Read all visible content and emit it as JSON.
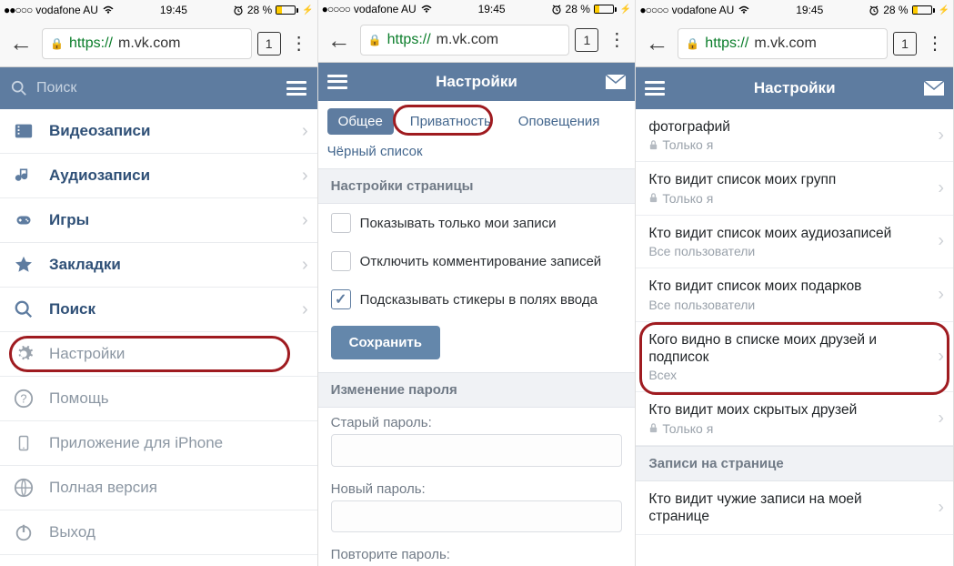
{
  "status": {
    "carrier": "vodafone AU",
    "time": "19:45",
    "battery_pct": "28 %"
  },
  "chrome": {
    "url_prefix": "https://",
    "url_host": "m.vk.com",
    "tabs": "1"
  },
  "pane1": {
    "search_placeholder": "Поиск",
    "menu": [
      {
        "icon": "video",
        "label": "Видеозаписи",
        "active": true
      },
      {
        "icon": "audio",
        "label": "Аудиозаписи",
        "active": true
      },
      {
        "icon": "games",
        "label": "Игры",
        "active": true
      },
      {
        "icon": "star",
        "label": "Закладки",
        "active": true
      },
      {
        "icon": "search",
        "label": "Поиск",
        "active": true
      },
      {
        "icon": "gear",
        "label": "Настройки",
        "active": false,
        "highlighted": true
      },
      {
        "icon": "help",
        "label": "Помощь",
        "active": false
      },
      {
        "icon": "phone",
        "label": "Приложение для iPhone",
        "active": false
      },
      {
        "icon": "globe",
        "label": "Полная версия",
        "active": false
      },
      {
        "icon": "power",
        "label": "Выход",
        "active": false
      }
    ]
  },
  "pane2": {
    "title": "Настройки",
    "tabs": [
      "Общее",
      "Приватность",
      "Оповещения"
    ],
    "blacklist": "Чёрный список",
    "section1": "Настройки страницы",
    "checks": [
      {
        "label": "Показывать только мои записи",
        "checked": false
      },
      {
        "label": "Отключить комментирование записей",
        "checked": false
      },
      {
        "label": "Подсказывать стикеры в полях ввода",
        "checked": true
      }
    ],
    "save": "Сохранить",
    "section2": "Изменение пароля",
    "old_pwd": "Старый пароль:",
    "new_pwd": "Новый пароль:",
    "repeat_pwd": "Повторите пароль:"
  },
  "pane3": {
    "title": "Настройки",
    "items": [
      {
        "title": "фотографий",
        "sub": "Только я",
        "locked": true
      },
      {
        "title": "Кто видит список моих групп",
        "sub": "Только я",
        "locked": true
      },
      {
        "title": "Кто видит список моих аудиозаписей",
        "sub": "Все пользователи",
        "locked": false
      },
      {
        "title": "Кто видит список моих подарков",
        "sub": "Все пользователи",
        "locked": false
      },
      {
        "title": "Кого видно в списке моих друзей и подписок",
        "sub": "Всех",
        "locked": false,
        "highlighted": true
      },
      {
        "title": "Кто видит моих скрытых друзей",
        "sub": "Только я",
        "locked": true
      }
    ],
    "section": "Записи на странице",
    "last": {
      "title": "Кто видит чужие записи на моей странице"
    }
  }
}
